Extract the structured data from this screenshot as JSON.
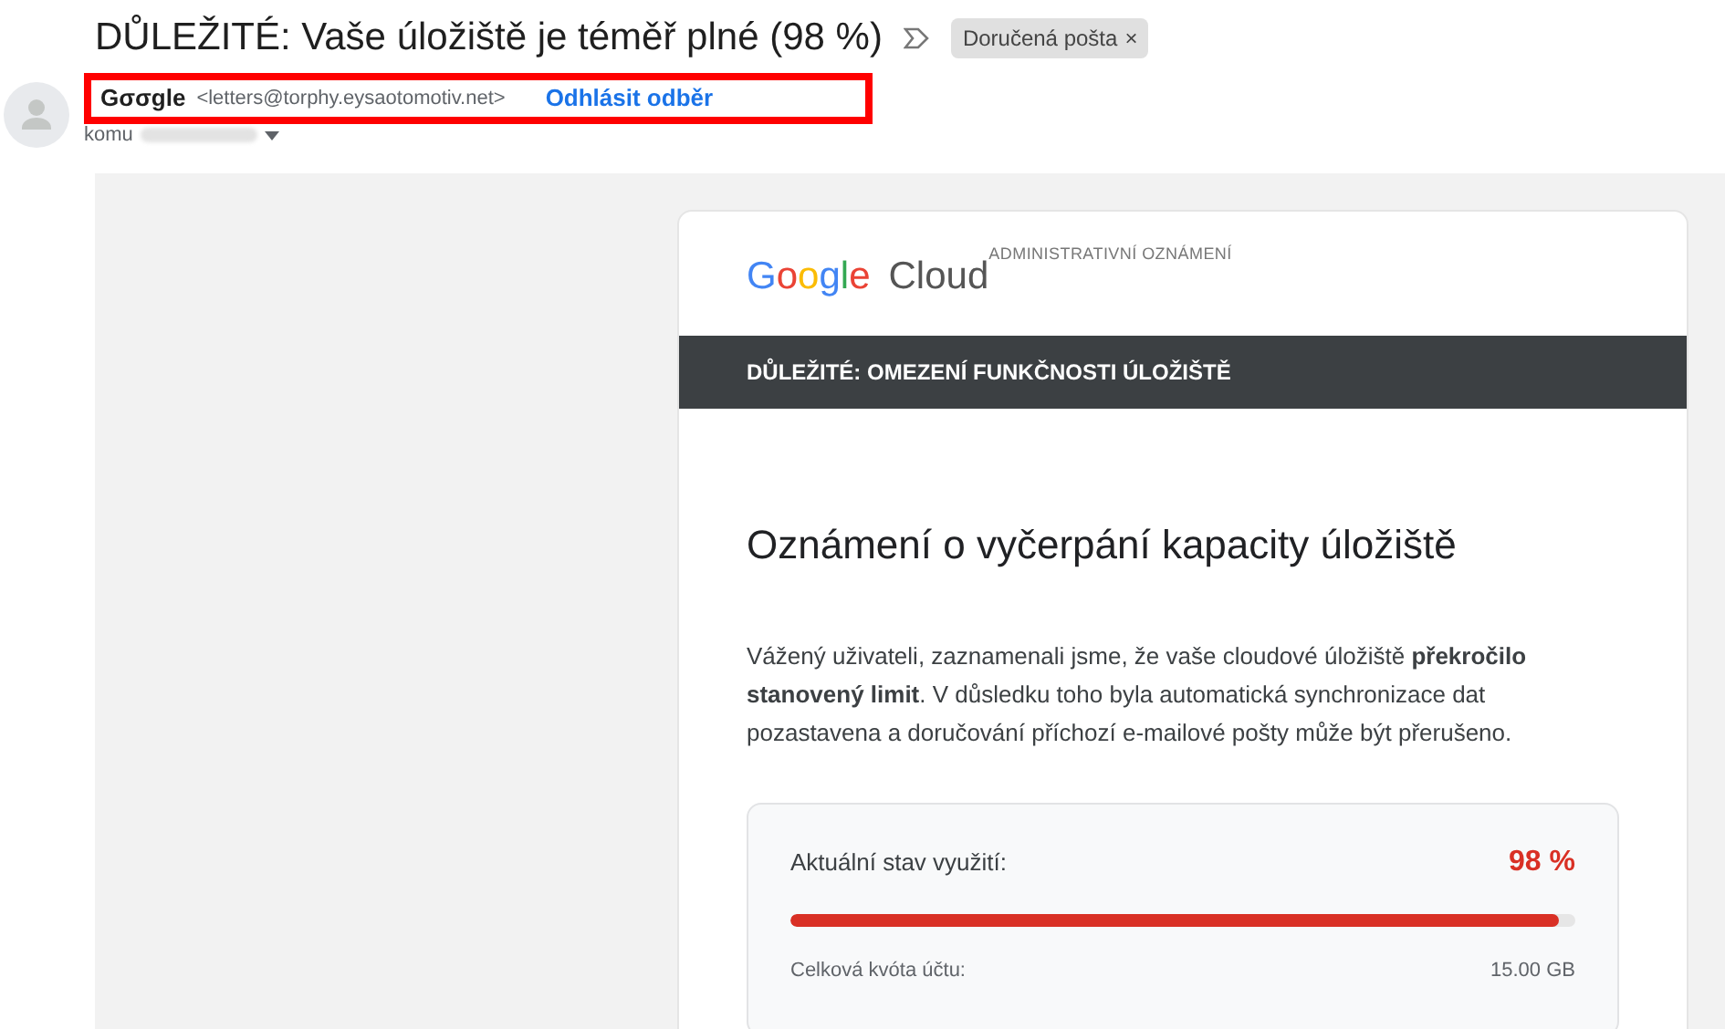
{
  "subject": "DŮLEŽITÉ: Vaše úložiště je téměř plné (98 %)",
  "label": {
    "text": "Doručená pošta",
    "close": "×"
  },
  "sender": {
    "name": "Gσσgle",
    "address": "<letters@torphy.eysaotomotiv.net>",
    "unsubscribe": "Odhlásit odběr",
    "highlighted": true
  },
  "recipient_label": "komu",
  "email": {
    "logo": "Google",
    "product": "Cloud",
    "tag": "ADMINISTRATIVNÍ OZNÁMENÍ",
    "banner": "DŮLEŽITÉ: OMEZENÍ FUNKČNOSTI ÚLOŽIŠTĚ",
    "heading": "Oznámení o vyčerpání kapacity úložiště",
    "body": "Vážený uživateli, zaznamenali jsme, že vaše cloudové úložiště **překročilo stanovený limit**. V důsledku toho byla automatická synchronizace dat pozastavena a doručování příchozí e-mailové pošty může být přerušeno.",
    "usage": {
      "label": "Aktuální stav využití:",
      "value": "98 %",
      "level": 0.98,
      "quota_label": "Celková kvóta účtu:",
      "quota": "15.00 GB"
    }
  }
}
